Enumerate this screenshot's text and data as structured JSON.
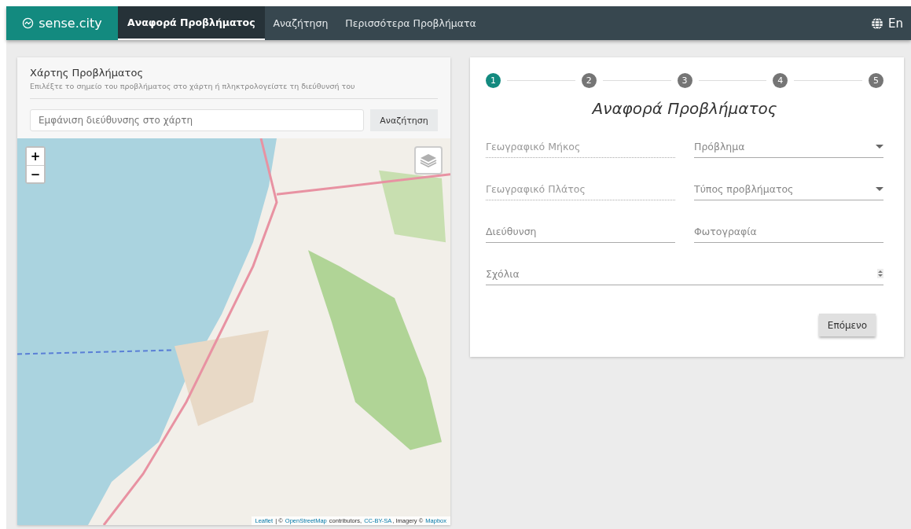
{
  "navbar": {
    "brand": "sense.city",
    "tabs": [
      {
        "label": "Αναφορά Προβλήματος",
        "selected": true
      },
      {
        "label": "Αναζήτηση",
        "selected": false
      },
      {
        "label": "Περισσότερα Προβλήματα",
        "selected": false
      }
    ],
    "language": "En"
  },
  "map_panel": {
    "title": "Χάρτης Προβλήματος",
    "subtitle": "Επιλέξτε το σημείο του προβλήματος στο χάρτη ή πληκτρολογείστε τη διεύθυνσή του",
    "search": {
      "placeholder": "Εμφάνιση διεύθυνσης στο χάρτη",
      "button": "Αναζήτηση"
    },
    "zoom_in": "+",
    "zoom_out": "−",
    "attribution": [
      {
        "text": "Leaflet",
        "link": true
      },
      {
        "text": " | © ",
        "link": false
      },
      {
        "text": "OpenStreetMap",
        "link": true
      },
      {
        "text": " contributors, ",
        "link": false
      },
      {
        "text": "CC-BY-SA",
        "link": true
      },
      {
        "text": ", Imagery © ",
        "link": false
      },
      {
        "text": "Mapbox",
        "link": true
      }
    ]
  },
  "form": {
    "steps": [
      {
        "label": "1",
        "selected": true
      },
      {
        "label": "2",
        "selected": false
      },
      {
        "label": "3",
        "selected": false
      },
      {
        "label": "4",
        "selected": false
      },
      {
        "label": "5",
        "selected": false
      }
    ],
    "title": "Αναφορά Προβλήματος",
    "fields": [
      {
        "placeholder": "Γεωγραφικό Μήκος",
        "kind": "text",
        "disabled": true
      },
      {
        "placeholder": "Πρόβλημα",
        "kind": "select",
        "disabled": false
      },
      {
        "placeholder": "Γεωγραφικό Πλάτος",
        "kind": "text",
        "disabled": true
      },
      {
        "placeholder": "Τύπος προβλήματος",
        "kind": "select",
        "disabled": false
      },
      {
        "placeholder": "Διεύθυνση",
        "kind": "text",
        "disabled": false
      },
      {
        "placeholder": "Φωτογραφία",
        "kind": "text",
        "disabled": false
      },
      {
        "placeholder": "Σχόλια",
        "kind": "textarea",
        "disabled": false
      }
    ],
    "next_button": "Επόμενο"
  }
}
